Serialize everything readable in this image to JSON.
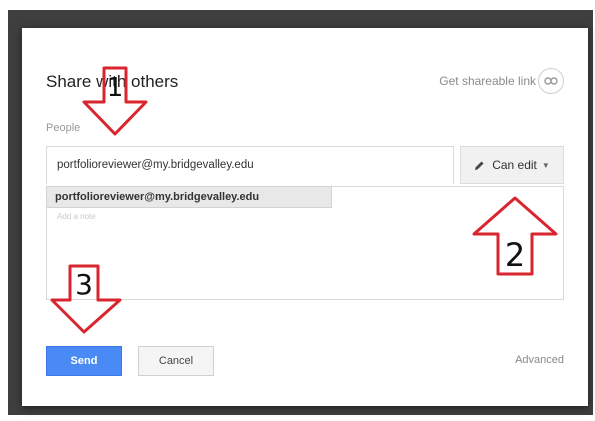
{
  "dialog": {
    "title": "Share with others",
    "shareable_link_label": "Get shareable link",
    "people_label": "People",
    "people_input_value": "portfolioreviewer@my.bridgevalley.edu",
    "permission_label": "Can edit",
    "suggestion": "portfolioreviewer@my.bridgevalley.edu",
    "note_placeholder": "Add a note",
    "send_label": "Send",
    "cancel_label": "Cancel",
    "advanced_label": "Advanced"
  },
  "annotations": {
    "step_1": "1",
    "step_2": "2",
    "step_3": "3"
  },
  "colors": {
    "send_button": "#4a8af4",
    "annotation_arrow": "#d9262e"
  },
  "icons": [
    "link-icon",
    "pencil-icon",
    "chevron-down-icon"
  ]
}
